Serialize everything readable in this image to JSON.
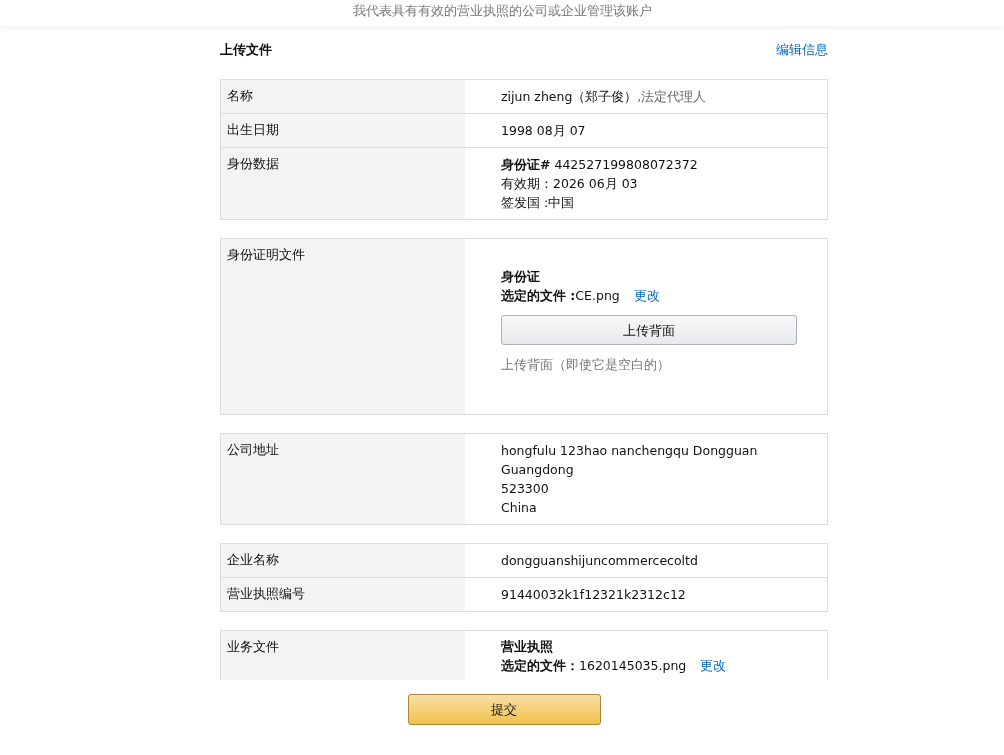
{
  "notice": "我代表具有有效的营业执照的公司或企业管理该账户",
  "header": {
    "title": "上传文件",
    "edit_link": "编辑信息"
  },
  "sections": [
    {
      "rows": [
        {
          "label": "名称",
          "kind": "name",
          "value": "zijun zheng（郑子俊）",
          "role": ",法定代理人"
        },
        {
          "label": "出生日期",
          "kind": "lines",
          "lines": [
            "1998 08月 07"
          ]
        },
        {
          "label": "身份数据",
          "kind": "lines",
          "lines": [
            "**身份证#** 442527199808072372",
            "有效期：2026 06月 03",
            "签发国 :中国"
          ]
        }
      ]
    },
    {
      "rows": [
        {
          "label": "身份证明文件",
          "kind": "upload",
          "doc_title": "身份证",
          "file_label": "选定的文件 :",
          "file_name": "CE.png",
          "change_link": "更改",
          "button": "上传背面",
          "hint": "上传背面（即使它是空白的）"
        }
      ]
    },
    {
      "rows": [
        {
          "label": "公司地址",
          "kind": "lines",
          "lines": [
            "hongfulu 123hao nanchengqu Dongguan",
            "Guangdong",
            "523300",
            "China"
          ]
        }
      ]
    },
    {
      "rows": [
        {
          "label": "企业名称",
          "kind": "lines",
          "lines": [
            "dongguanshijuncommercecoltd"
          ]
        },
        {
          "label": "营业执照编号",
          "kind": "lines",
          "lines": [
            "91440032k1f12321k2312c12"
          ]
        }
      ]
    },
    {
      "rows": [
        {
          "label": "业务文件",
          "kind": "upload",
          "doc_title": "营业执照",
          "file_label": "选定的文件：",
          "file_name": "1620145035.png",
          "change_link": "更改"
        }
      ]
    }
  ],
  "submit_button": "提交"
}
